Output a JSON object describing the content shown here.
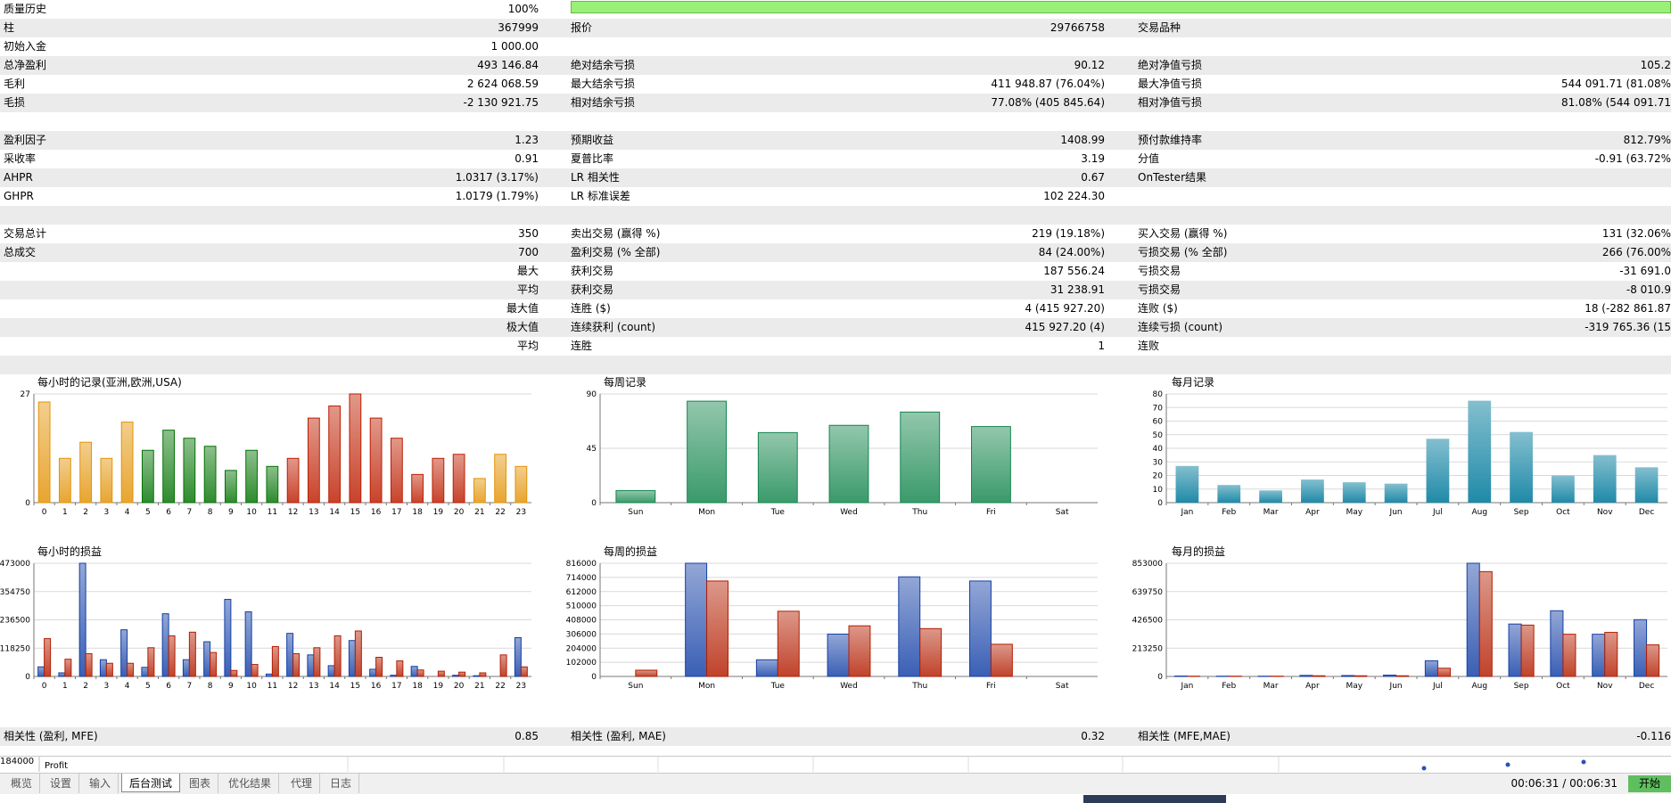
{
  "stats_rows": [
    {
      "l1": "质量历史",
      "v1": "100%",
      "l2": "",
      "v2": "",
      "l3": "",
      "v3": "",
      "bar": true
    },
    {
      "l1": "柱",
      "v1": "367999",
      "l2": "报价",
      "v2": "29766758",
      "l3": "交易品种",
      "v3": ""
    },
    {
      "l1": "初始入金",
      "v1": "1 000.00",
      "l2": "",
      "v2": "",
      "l3": "",
      "v3": ""
    },
    {
      "l1": "总净盈利",
      "v1": "493 146.84",
      "l2": "绝对结余亏损",
      "v2": "90.12",
      "l3": "绝对净值亏损",
      "v3": "105.2"
    },
    {
      "l1": "毛利",
      "v1": "2 624 068.59",
      "l2": "最大结余亏损",
      "v2": "411 948.87 (76.04%)",
      "l3": "最大净值亏损",
      "v3": "544 091.71 (81.08%"
    },
    {
      "l1": "毛损",
      "v1": "-2 130 921.75",
      "l2": "相对结余亏损",
      "v2": "77.08% (405 845.64)",
      "l3": "相对净值亏损",
      "v3": "81.08% (544 091.71"
    },
    {
      "l1": "",
      "v1": "",
      "l2": "",
      "v2": "",
      "l3": "",
      "v3": ""
    },
    {
      "l1": "盈利因子",
      "v1": "1.23",
      "l2": "预期收益",
      "v2": "1408.99",
      "l3": "预付款维持率",
      "v3": "812.79%"
    },
    {
      "l1": "采收率",
      "v1": "0.91",
      "l2": "夏普比率",
      "v2": "3.19",
      "l3": "分值",
      "v3": "-0.91 (63.72%"
    },
    {
      "l1": "AHPR",
      "v1": "1.0317 (3.17%)",
      "l2": "LR 相关性",
      "v2": "0.67",
      "l3": "OnTester结果",
      "v3": ""
    },
    {
      "l1": "GHPR",
      "v1": "1.0179 (1.79%)",
      "l2": "LR 标准误差",
      "v2": "102 224.30",
      "l3": "",
      "v3": ""
    },
    {
      "l1": "",
      "v1": "",
      "l2": "",
      "v2": "",
      "l3": "",
      "v3": ""
    },
    {
      "l1": "交易总计",
      "v1": "350",
      "l2": "卖出交易 (赢得 %)",
      "v2": "219 (19.18%)",
      "l3": "买入交易 (赢得 %)",
      "v3": "131 (32.06%"
    },
    {
      "l1": "总成交",
      "v1": "700",
      "l2": "盈利交易 (% 全部)",
      "v2": "84 (24.00%)",
      "l3": "亏损交易 (% 全部)",
      "v3": "266 (76.00%"
    },
    {
      "l1": "",
      "v1": "最大",
      "l2": "获利交易",
      "v2": "187 556.24",
      "l3": "亏损交易",
      "v3": "-31 691.0"
    },
    {
      "l1": "",
      "v1": "平均",
      "l2": "获利交易",
      "v2": "31 238.91",
      "l3": "亏损交易",
      "v3": "-8 010.9"
    },
    {
      "l1": "",
      "v1": "最大值",
      "l2": "连胜 ($)",
      "v2": "4 (415 927.20)",
      "l3": "连败 ($)",
      "v3": "18 (-282 861.87"
    },
    {
      "l1": "",
      "v1": "极大值",
      "l2": "连续获利 (count)",
      "v2": "415 927.20 (4)",
      "l3": "连续亏损 (count)",
      "v3": "-319 765.36 (15"
    },
    {
      "l1": "",
      "v1": "平均",
      "l2": "连胜",
      "v2": "1",
      "l3": "连败",
      "v3": ""
    },
    {
      "l1": "",
      "v1": "",
      "l2": "",
      "v2": "",
      "l3": "",
      "v3": ""
    }
  ],
  "charts": {
    "hourly_count": {
      "title": "每小时的记录(亚洲,欧洲,USA)"
    },
    "weekly_count": {
      "title": "每周记录"
    },
    "monthly_count": {
      "title": "每月记录"
    },
    "hourly_pl": {
      "title": "每小时的损益"
    },
    "weekly_pl": {
      "title": "每周的损益"
    },
    "monthly_pl": {
      "title": "每月的损益"
    }
  },
  "chart_data": [
    {
      "type": "bar",
      "title": "每小时的记录(亚洲,欧洲,USA)",
      "categories": [
        "0",
        "1",
        "2",
        "3",
        "4",
        "5",
        "6",
        "7",
        "8",
        "9",
        "10",
        "11",
        "12",
        "13",
        "14",
        "15",
        "16",
        "17",
        "18",
        "19",
        "20",
        "21",
        "22",
        "23"
      ],
      "values": [
        25,
        11,
        15,
        11,
        20,
        13,
        18,
        16,
        14,
        8,
        13,
        9,
        11,
        21,
        24,
        27,
        21,
        16,
        7,
        11,
        12,
        6,
        12,
        9
      ],
      "ylim": [
        0,
        27
      ],
      "yticks": [
        "0",
        "27"
      ],
      "colors": [
        "#e8a530",
        "#e8a530",
        "#e8a530",
        "#e8a530",
        "#e8a530",
        "#2e8b2e",
        "#2e8b2e",
        "#2e8b2e",
        "#2e8b2e",
        "#2e8b2e",
        "#2e8b2e",
        "#2e8b2e",
        "#c8432b",
        "#c8432b",
        "#c8432b",
        "#c8432b",
        "#c8432b",
        "#c8432b",
        "#c8432b",
        "#c8432b",
        "#c8432b",
        "#e8a530",
        "#e8a530",
        "#e8a530"
      ]
    },
    {
      "type": "bar",
      "title": "每周记录",
      "categories": [
        "Sun",
        "Mon",
        "Tue",
        "Wed",
        "Thu",
        "Fri",
        "Sat"
      ],
      "values": [
        10,
        84,
        58,
        64,
        75,
        63,
        0
      ],
      "ylim": [
        0,
        90
      ],
      "yticks": [
        "0",
        "45",
        "90"
      ],
      "colors": [
        "#3a9a6a"
      ]
    },
    {
      "type": "bar",
      "title": "每月记录",
      "categories": [
        "Jan",
        "Feb",
        "Mar",
        "Apr",
        "May",
        "Jun",
        "Jul",
        "Aug",
        "Sep",
        "Oct",
        "Nov",
        "Dec"
      ],
      "values": [
        27,
        13,
        9,
        17,
        15,
        14,
        47,
        75,
        52,
        20,
        35,
        26
      ],
      "ylim": [
        0,
        80
      ],
      "yticks": [
        "0",
        "10",
        "20",
        "30",
        "40",
        "50",
        "60",
        "70",
        "80"
      ],
      "colors": [
        "#1f8aa8"
      ]
    },
    {
      "type": "bar",
      "title": "每小时的损益",
      "categories": [
        "0",
        "1",
        "2",
        "3",
        "4",
        "5",
        "6",
        "7",
        "8",
        "9",
        "10",
        "11",
        "12",
        "13",
        "14",
        "15",
        "16",
        "17",
        "18",
        "19",
        "20",
        "21",
        "22",
        "23"
      ],
      "series": [
        {
          "values": [
            40000,
            15000,
            473000,
            70000,
            195000,
            38000,
            262000,
            70000,
            145000,
            322000,
            270000,
            10000,
            180000,
            90000,
            45000,
            150000,
            30000,
            5000,
            42000,
            0,
            5000,
            3000,
            0,
            162000
          ]
        },
        {
          "values": [
            158000,
            72000,
            95000,
            55000,
            55000,
            120000,
            170000,
            185000,
            100000,
            25000,
            50000,
            125000,
            95000,
            120000,
            170000,
            190000,
            80000,
            65000,
            27000,
            22000,
            18000,
            15000,
            90000,
            40000
          ]
        }
      ],
      "ylim": [
        0,
        473000
      ],
      "yticks": [
        "0",
        "118250",
        "236500",
        "354750",
        "473000"
      ],
      "colors": [
        "#3a5fb5",
        "#c0432b"
      ]
    },
    {
      "type": "bar",
      "title": "每周的损益",
      "categories": [
        "Sun",
        "Mon",
        "Tue",
        "Wed",
        "Thu",
        "Fri",
        "Sat"
      ],
      "series": [
        {
          "values": [
            0,
            816000,
            120000,
            305000,
            718000,
            688000,
            0
          ]
        },
        {
          "values": [
            45000,
            688000,
            470000,
            365000,
            345000,
            232000,
            0
          ]
        }
      ],
      "ylim": [
        0,
        816000
      ],
      "yticks": [
        "0",
        "102000",
        "204000",
        "306000",
        "408000",
        "510000",
        "612000",
        "714000",
        "816000"
      ],
      "colors": [
        "#3a5fb5",
        "#c0432b"
      ]
    },
    {
      "type": "bar",
      "title": "每月的损益",
      "categories": [
        "Jan",
        "Feb",
        "Mar",
        "Apr",
        "May",
        "Jun",
        "Jul",
        "Aug",
        "Sep",
        "Oct",
        "Nov",
        "Dec"
      ],
      "series": [
        {
          "values": [
            3000,
            2000,
            2000,
            8000,
            7000,
            10000,
            118000,
            853000,
            395000,
            495000,
            318000,
            428000
          ]
        },
        {
          "values": [
            2000,
            2000,
            2000,
            5000,
            5000,
            5000,
            62000,
            790000,
            387000,
            318000,
            332000,
            238000
          ]
        }
      ],
      "ylim": [
        0,
        853000
      ],
      "yticks": [
        "0",
        "213250",
        "426500",
        "639750",
        "853000"
      ],
      "colors": [
        "#3a5fb5",
        "#c0432b"
      ]
    }
  ],
  "correlations": {
    "l1": "相关性 (盈利, MFE)",
    "v1": "0.85",
    "l2": "相关性 (盈利, MAE)",
    "v2": "0.32",
    "l3": "相关性 (MFE,MAE)",
    "v3": "-0.116"
  },
  "bottom_chart": {
    "ytick": "184000",
    "label": "Profit"
  },
  "tabs": [
    "概览",
    "设置",
    "输入",
    "后台测试",
    "图表",
    "优化结果",
    "代理",
    "日志"
  ],
  "active_tab": "后台测试",
  "timer": "00:06:31 / 00:06:31",
  "start_label": "开始"
}
